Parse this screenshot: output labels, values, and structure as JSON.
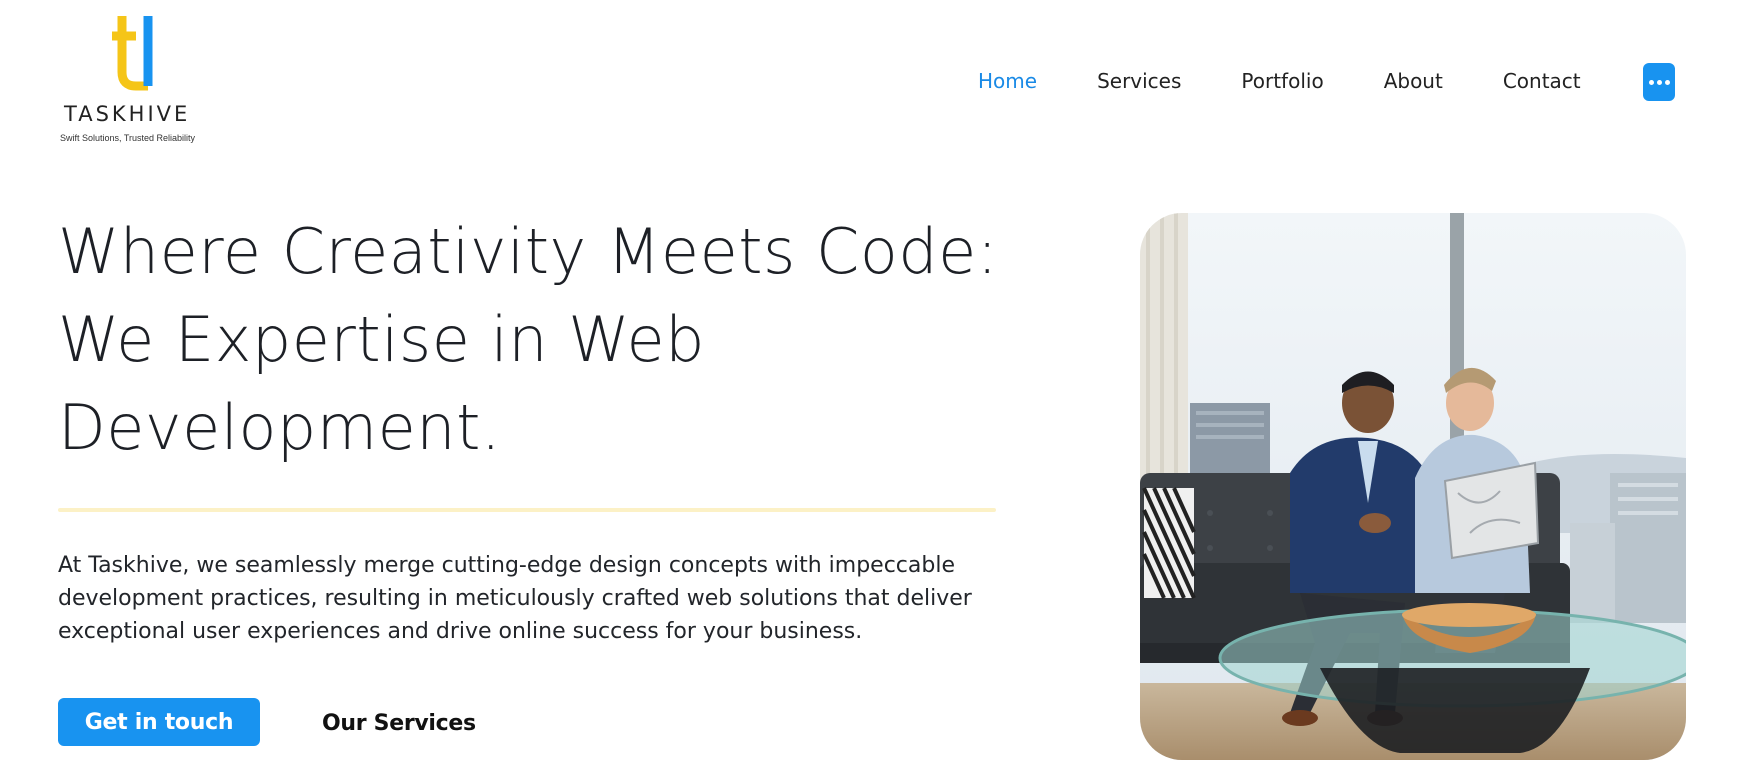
{
  "brand": {
    "name": "TASKHIVE",
    "tagline": "Swift Solutions, Trusted Reliability",
    "logo_icon": "tl-monogram-logo",
    "colors": {
      "logo_yellow": "#f5c518",
      "logo_blue": "#1893f0"
    }
  },
  "nav": {
    "items": [
      {
        "label": "Home",
        "active": true
      },
      {
        "label": "Services",
        "active": false
      },
      {
        "label": "Portfolio",
        "active": false
      },
      {
        "label": "About",
        "active": false
      },
      {
        "label": "Contact",
        "active": false
      }
    ],
    "more_icon": "more-horizontal-icon"
  },
  "hero": {
    "heading_lines": [
      "Where Creativity Meets Code:",
      "We Expertise in Web",
      "Development."
    ],
    "description_lines": [
      "At Taskhive, we seamlessly merge cutting-edge design concepts with impeccable",
      "development practices, resulting in meticulously crafted web solutions that deliver",
      "exceptional user experiences and drive online success for your business."
    ],
    "primary_cta": "Get in touch",
    "secondary_cta": "Our Services",
    "image_subject": "two-men-laptop-office-photo"
  },
  "colors": {
    "accent": "#1893f0",
    "nav_active": "#1a8ae6",
    "divider": "#fcf1c6",
    "text": "#1d2026"
  }
}
